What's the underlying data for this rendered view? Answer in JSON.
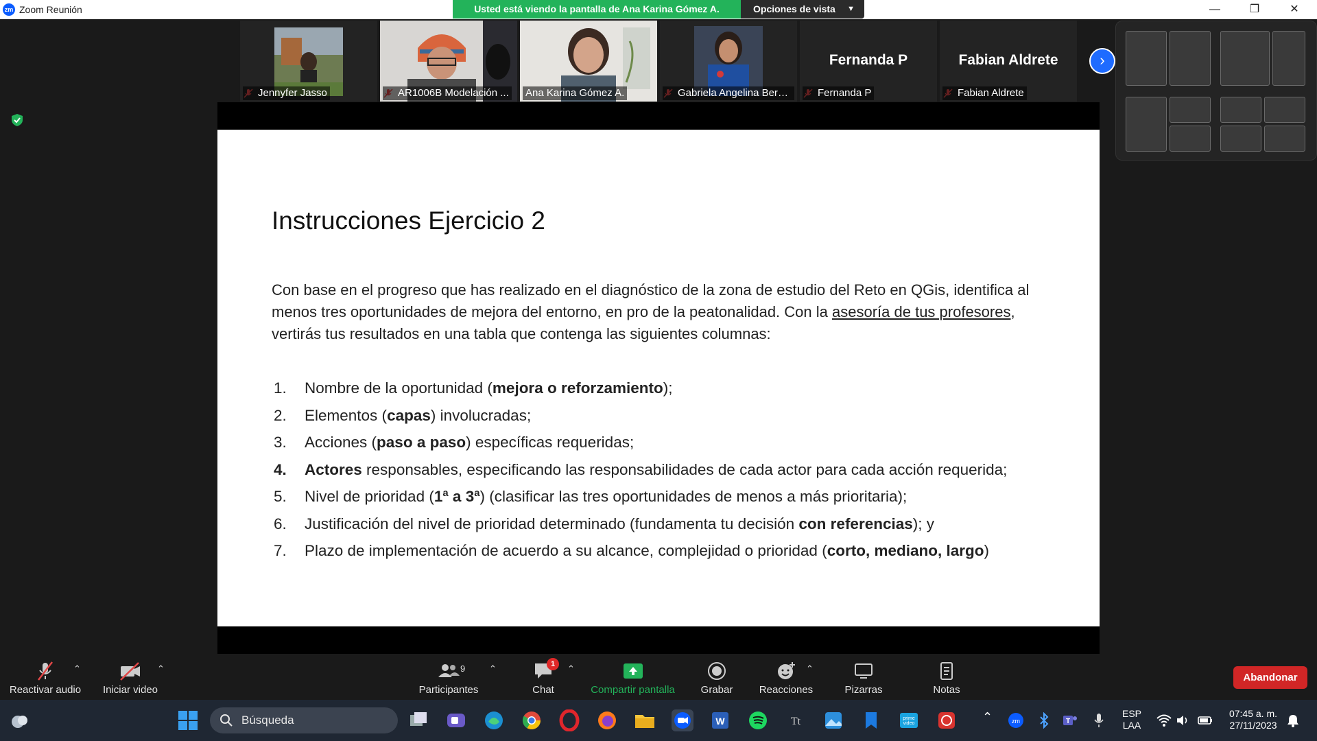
{
  "window": {
    "title": "Zoom Reunión",
    "share_banner": "Usted está viendo la pantalla de Ana Karina Gómez A.",
    "view_options": "Opciones de vista"
  },
  "participants": [
    {
      "name": "Jennyfer Jasso",
      "muted": true
    },
    {
      "name": "AR1006B Modelación ...",
      "muted": true
    },
    {
      "name": "Ana Karina Gómez A.",
      "muted": false
    },
    {
      "name": "Gabriela Angelina Bern...",
      "muted": true
    },
    {
      "name": "Fernanda P",
      "muted": true,
      "display_name": "Fernanda P"
    },
    {
      "name": "Fabian Aldrete",
      "muted": true,
      "display_name": "Fabian Aldrete"
    }
  ],
  "slide": {
    "title": "Instrucciones Ejercicio 2",
    "intro_before_link": "Con base en el progreso que has realizado en el diagnóstico de la zona de estudio del Reto en QGis, identifica al menos tres oportunidades de mejora del entorno, en pro de la peatonalidad. Con la ",
    "intro_link": "asesoría de tus profesores",
    "intro_after_link": ", vertirás tus resultados en una tabla que contenga las siguientes columnas:",
    "items": [
      {
        "num": "1.",
        "pre": "Nombre de la oportunidad (",
        "bold": "mejora o reforzamiento",
        "post": ");"
      },
      {
        "num": "2.",
        "pre": "Elementos (",
        "bold": "capas",
        "post": ") involucradas;"
      },
      {
        "num": "3.",
        "pre": "Acciones (",
        "bold": "paso a paso",
        "post": ") específicas requeridas;"
      },
      {
        "num": "4.",
        "pre": "",
        "bold": "Actores",
        "post": " responsables, especificando las responsabilidades de cada actor para cada acción requerida;"
      },
      {
        "num": "5.",
        "pre": "Nivel de prioridad (",
        "bold": "1ª a 3ª",
        "post": ") (clasificar las tres oportunidades de menos a más prioritaria);"
      },
      {
        "num": "6.",
        "pre": "Justificación del nivel de prioridad determinado (fundamenta tu decisión ",
        "bold": "con referencias",
        "post": "); y"
      },
      {
        "num": "7.",
        "pre": "Plazo de implementación de acuerdo a su alcance, complejidad o prioridad (",
        "bold": "corto, mediano, largo",
        "post": ")"
      }
    ]
  },
  "toolbar": {
    "unmute": "Reactivar audio",
    "start_video": "Iniciar video",
    "participants": "Participantes",
    "participants_count": "9",
    "chat": "Chat",
    "chat_badge": "1",
    "share": "Compartir pantalla",
    "record": "Grabar",
    "reactions": "Reacciones",
    "whiteboards": "Pizarras",
    "notes": "Notas",
    "leave": "Abandonar"
  },
  "taskbar": {
    "search_placeholder": "Búsqueda",
    "lang_top": "ESP",
    "lang_bottom": "LAA",
    "time": "07:45 a. m.",
    "date": "27/11/2023"
  },
  "colors": {
    "zoom_blue": "#0b5cff",
    "share_green": "#23b35a",
    "leave_red": "#d12626",
    "mute_red": "#e04646"
  }
}
